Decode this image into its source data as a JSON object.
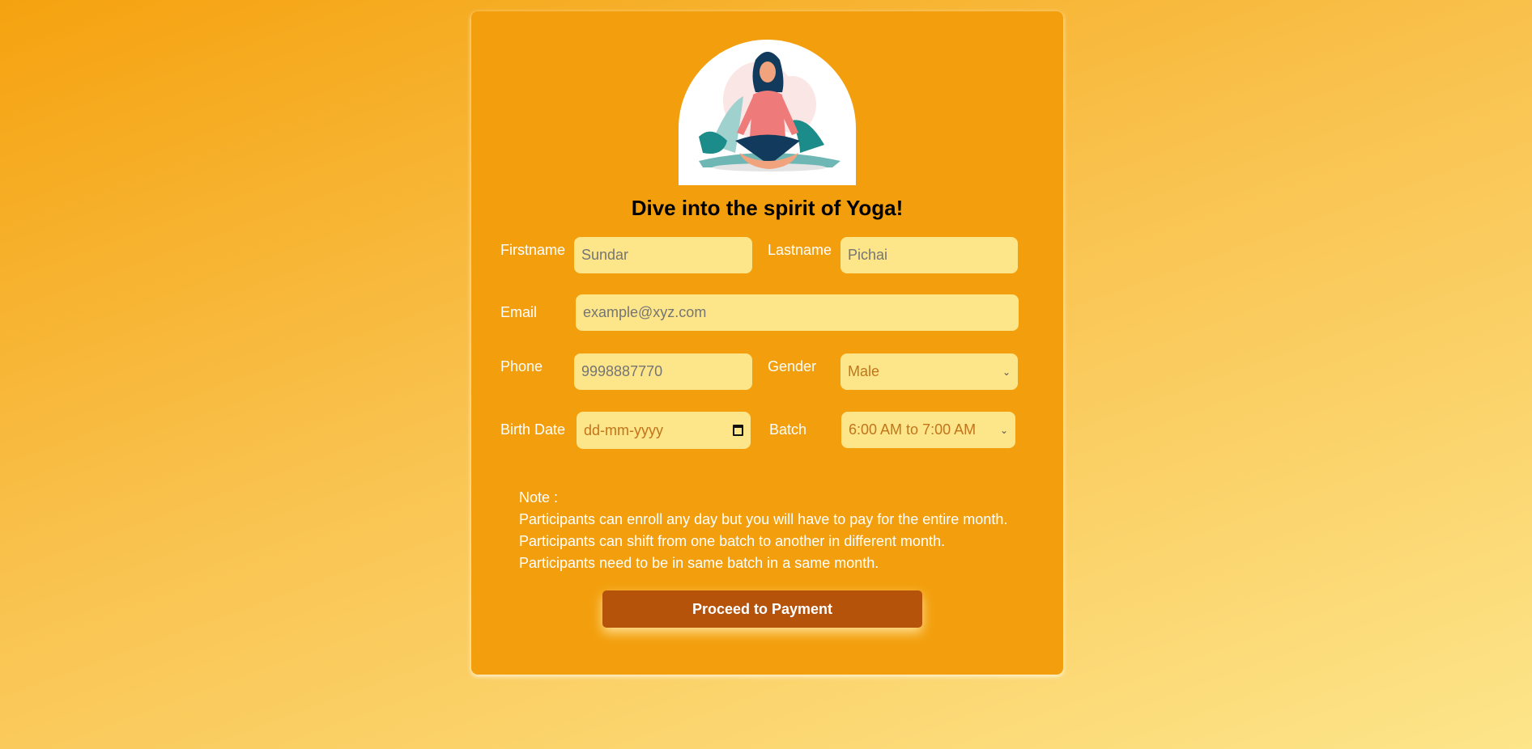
{
  "title": "Dive into the spirit of Yoga!",
  "form": {
    "firstname": {
      "label": "Firstname",
      "placeholder": "Sundar"
    },
    "lastname": {
      "label": "Lastname",
      "placeholder": "Pichai"
    },
    "email": {
      "label": "Email",
      "placeholder": "example@xyz.com"
    },
    "phone": {
      "label": "Phone",
      "placeholder": "9998887770"
    },
    "gender": {
      "label": "Gender",
      "value": "Male"
    },
    "birthdate": {
      "label": "Birth Date",
      "placeholder": "dd-mm-yyyy"
    },
    "batch": {
      "label": "Batch",
      "value": "6:00 AM to 7:00 AM"
    }
  },
  "note": {
    "heading": "Note :",
    "lines": [
      "Participants can enroll any day but you will have to pay for the entire month.",
      "Participants can shift from one batch to another in different month.",
      "Participants need to be in same batch in a same month."
    ]
  },
  "submit_label": "Proceed to Payment",
  "colors": {
    "card": "#f39f0d",
    "input": "#fde58a",
    "button": "#b5530a"
  }
}
